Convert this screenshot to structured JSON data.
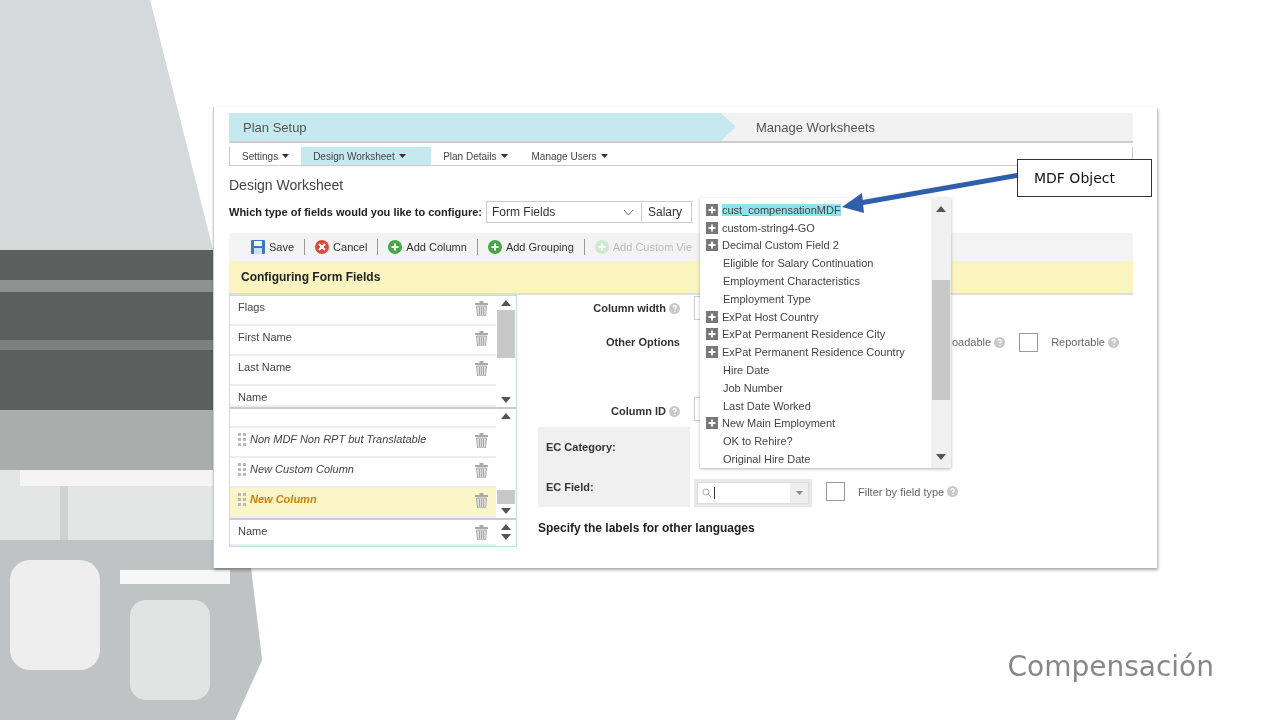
{
  "slide": {
    "title": "Compensación"
  },
  "breadcrumb": [
    {
      "label": "Plan Setup",
      "selected": true
    },
    {
      "label": "Manage Worksheets",
      "selected": false
    }
  ],
  "tabs": [
    {
      "label": "Settings",
      "selected": false
    },
    {
      "label": "Design Worksheet",
      "selected": true
    },
    {
      "label": "Plan Details",
      "selected": false
    },
    {
      "label": "Manage Users",
      "selected": false
    }
  ],
  "page_title": "Design Worksheet",
  "field_type": {
    "label": "Which type of fields would you like to configure:",
    "value": "Form Fields",
    "second_value": "Salary"
  },
  "toolbar": [
    {
      "label": "Save",
      "kind": "save",
      "disabled": false
    },
    {
      "label": "Cancel",
      "kind": "cancel",
      "disabled": false
    },
    {
      "label": "Add Column",
      "kind": "add",
      "disabled": false
    },
    {
      "label": "Add Grouping",
      "kind": "add",
      "disabled": false
    },
    {
      "label": "Add Custom Vie",
      "kind": "add",
      "disabled": true
    }
  ],
  "section_title": "Configuring Form Fields",
  "upper_list": {
    "items": [
      {
        "label": "Flags",
        "kind": "standard",
        "selected": false
      },
      {
        "label": "First Name",
        "kind": "standard",
        "selected": false
      },
      {
        "label": "Last Name",
        "kind": "standard",
        "selected": false
      }
    ],
    "footer": "Name"
  },
  "lower_list": {
    "items": [
      {
        "label": "Non MDF Non RPT but Translatable",
        "kind": "custom",
        "selected": false
      },
      {
        "label": "New Custom Column",
        "kind": "custom",
        "selected": false
      },
      {
        "label": "New Column",
        "kind": "custom",
        "selected": true
      }
    ],
    "footer": "Name"
  },
  "properties": {
    "column_width_label": "Column width",
    "other_options_label": "Other Options",
    "options": [
      {
        "label": "oadable",
        "kind": "text"
      },
      {
        "label": "Reportable",
        "kind": "checkbox",
        "checked": false
      }
    ],
    "column_id_label": "Column ID",
    "ec_category_label": "EC Category:",
    "ec_field_label": "EC Field:",
    "filter": {
      "label": "Filter by field type",
      "checked": false
    },
    "languages_heading": "Specify the labels for other languages"
  },
  "dropdown": {
    "items": [
      {
        "label": "cust_compensationMDF",
        "expandable": true,
        "selected": true
      },
      {
        "label": "custom-string4-GO",
        "expandable": true,
        "selected": false
      },
      {
        "label": "Decimal Custom Field 2",
        "expandable": true,
        "selected": false
      },
      {
        "label": "Eligible for Salary Continuation",
        "expandable": false,
        "selected": false
      },
      {
        "label": "Employment Characteristics",
        "expandable": false,
        "selected": false
      },
      {
        "label": "Employment Type",
        "expandable": false,
        "selected": false
      },
      {
        "label": "ExPat Host Country",
        "expandable": true,
        "selected": false
      },
      {
        "label": "ExPat Permanent Residence City",
        "expandable": true,
        "selected": false
      },
      {
        "label": "ExPat Permanent Residence Country",
        "expandable": true,
        "selected": false
      },
      {
        "label": "Hire Date",
        "expandable": false,
        "selected": false
      },
      {
        "label": "Job Number",
        "expandable": false,
        "selected": false
      },
      {
        "label": "Last Date Worked",
        "expandable": false,
        "selected": false
      },
      {
        "label": "New Main Employment",
        "expandable": true,
        "selected": false
      },
      {
        "label": "OK to Rehire?",
        "expandable": false,
        "selected": false
      },
      {
        "label": "Original Hire Date",
        "expandable": false,
        "selected": false
      }
    ]
  },
  "callout": {
    "label": "MDF Object"
  }
}
